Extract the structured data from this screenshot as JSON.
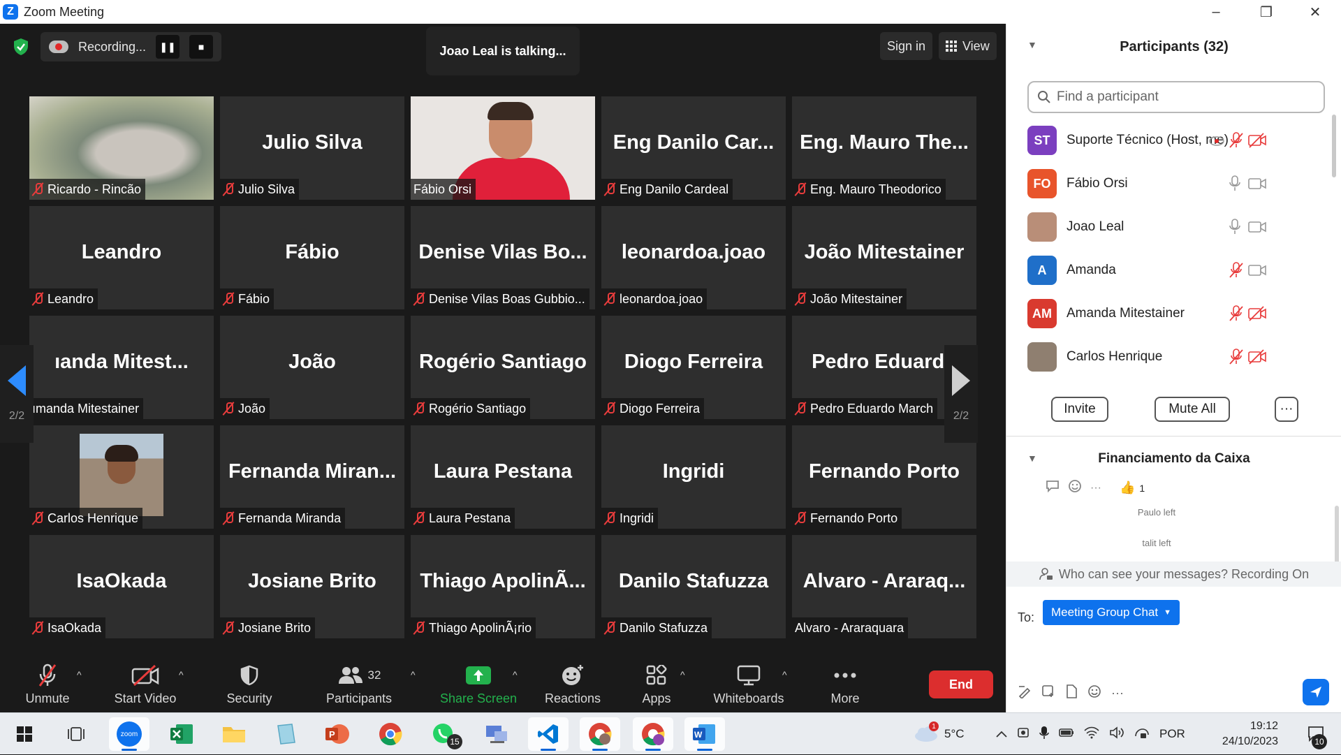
{
  "window": {
    "title": "Zoom Meeting",
    "minimize": "–",
    "restore": "❐",
    "close": "✕"
  },
  "topbar": {
    "recording_label": "Recording...",
    "pause_symbol": "❚❚",
    "stop_symbol": "■",
    "talking": "Joao Leal is talking...",
    "signin": "Sign in",
    "view": "View"
  },
  "tiles": [
    {
      "big": "",
      "name": "Ricardo - Rincão",
      "muted": true,
      "photo": "ricardo"
    },
    {
      "big": "Julio Silva",
      "name": "Julio Silva",
      "muted": true
    },
    {
      "big": "",
      "name": "Fábio Orsi",
      "muted": false,
      "photo": "fabio"
    },
    {
      "big": "Eng  Danilo Car...",
      "name": "Eng  Danilo Cardeal",
      "muted": true
    },
    {
      "big": "Eng. Mauro The...",
      "name": "Eng. Mauro Theodorico",
      "muted": true
    },
    {
      "big": "Leandro",
      "name": "Leandro",
      "muted": true
    },
    {
      "big": "Fábio",
      "name": "Fábio",
      "muted": true
    },
    {
      "big": "Denise Vilas Bo...",
      "name": "Denise Vilas Boas Gubbio...",
      "muted": true
    },
    {
      "big": "leonardoa.joao",
      "name": "leonardoa.joao",
      "muted": true
    },
    {
      "big": "João Mitestainer",
      "name": "João Mitestainer",
      "muted": true
    },
    {
      "big": "ıanda  Mitest...",
      "name": "ımanda Mitestainer",
      "muted": false
    },
    {
      "big": "João",
      "name": "João",
      "muted": true
    },
    {
      "big": "Rogério Santiago",
      "name": "Rogério Santiago",
      "muted": true
    },
    {
      "big": "Diogo Ferreira",
      "name": "Diogo Ferreira",
      "muted": true
    },
    {
      "big": "Pedro  Eduardo",
      "name": "Pedro Eduardo March",
      "muted": true
    },
    {
      "big": "",
      "name": "Carlos Henrique",
      "muted": true,
      "photo": "carlos"
    },
    {
      "big": "Fernanda  Miran...",
      "name": "Fernanda Miranda",
      "muted": true
    },
    {
      "big": "Laura Pestana",
      "name": "Laura Pestana",
      "muted": true
    },
    {
      "big": "Ingridi",
      "name": "Ingridi",
      "muted": true
    },
    {
      "big": "Fernando Porto",
      "name": "Fernando Porto",
      "muted": true
    },
    {
      "big": "IsaOkada",
      "name": "IsaOkada",
      "muted": true
    },
    {
      "big": "Josiane Brito",
      "name": "Josiane Brito",
      "muted": true
    },
    {
      "big": "Thiago  ApolinÃ...",
      "name": "Thiago ApolinÃ¡rio",
      "muted": true
    },
    {
      "big": "Danilo Stafuzza",
      "name": "Danilo Stafuzza",
      "muted": true
    },
    {
      "big": "Alvaro  -  Araraq...",
      "name": "Alvaro - Araraquara",
      "muted": false
    }
  ],
  "pager": {
    "left": "2/2",
    "right": "2/2"
  },
  "toolbar": {
    "unmute": "Unmute",
    "start_video": "Start Video",
    "security": "Security",
    "participants": "Participants",
    "participants_count": "32",
    "share_screen": "Share Screen",
    "reactions": "Reactions",
    "apps": "Apps",
    "whiteboards": "Whiteboards",
    "more": "More",
    "end": "End",
    "caret": "^"
  },
  "participants_panel": {
    "title": "Participants (32)",
    "search_placeholder": "Find a participant",
    "list": [
      {
        "initials": "ST",
        "name": "Suporte Técnico (Host, me)",
        "color": "#7b3fbf"
      },
      {
        "initials": "FO",
        "name": "Fábio Orsi",
        "color": "#e8542b"
      },
      {
        "initials": "",
        "name": "Joao Leal",
        "color": "#b98e78"
      },
      {
        "initials": "A",
        "name": "Amanda",
        "color": "#1f6fc9"
      },
      {
        "initials": "AM",
        "name": "Amanda Mitestainer",
        "color": "#d93a2f"
      },
      {
        "initials": "",
        "name": "Carlos Henrique",
        "color": "#8f7f70"
      }
    ],
    "invite": "Invite",
    "mute_all": "Mute All",
    "more": "···"
  },
  "chat_panel": {
    "title": "Financiamento da Caixa",
    "like_count": "1",
    "sys1": "Paulo left",
    "sys2": "talit left",
    "who_can_see": "Who can see your messages? Recording On",
    "to_label": "To:",
    "to_value": "Meeting Group Chat",
    "more": "···"
  },
  "taskbar": {
    "weather_temp": "5°C",
    "weather_badge": "1",
    "whatsapp_badge": "15",
    "lang": "POR",
    "time": "19:12",
    "date": "24/10/2023",
    "notif_count": "10",
    "zoom_label": "zoom"
  },
  "colors": {
    "accent": "#0e72ed",
    "muted_red": "#e83c3c",
    "share_green": "#23b14d",
    "end_red": "#dc2e2e"
  }
}
